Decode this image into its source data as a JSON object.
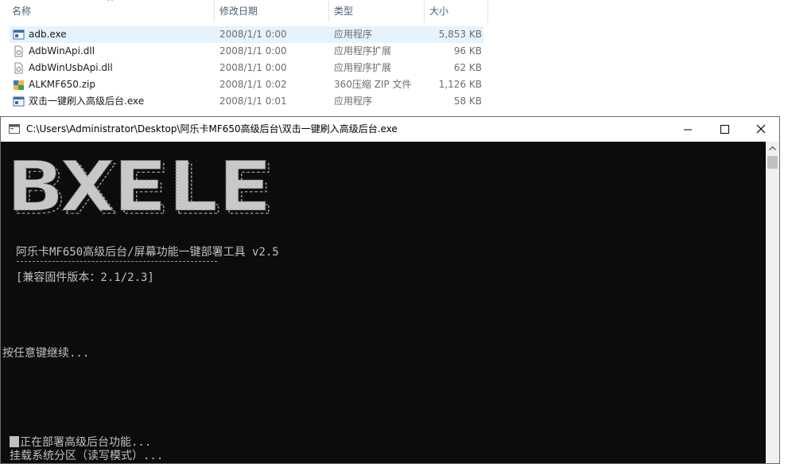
{
  "explorer": {
    "columns": {
      "name": "名称",
      "date": "修改日期",
      "type": "类型",
      "size": "大小"
    },
    "files": [
      {
        "name": "adb.exe",
        "date": "2008/1/1 0:00",
        "type": "应用程序",
        "size": "5,853 KB",
        "icon": "exe-icon",
        "selected": true
      },
      {
        "name": "AdbWinApi.dll",
        "date": "2008/1/1 0:00",
        "type": "应用程序扩展",
        "size": "96 KB",
        "icon": "dll-icon"
      },
      {
        "name": "AdbWinUsbApi.dll",
        "date": "2008/1/1 0:00",
        "type": "应用程序扩展",
        "size": "62 KB",
        "icon": "dll-icon"
      },
      {
        "name": "ALKMF650.zip",
        "date": "2008/1/1 0:02",
        "type": "360压缩 ZIP 文件",
        "size": "1,126 KB",
        "icon": "zip-icon"
      },
      {
        "name": "双击一键刷入高级后台.exe",
        "date": "2008/1/1 0:01",
        "type": "应用程序",
        "size": "58 KB",
        "icon": "exe-icon"
      }
    ]
  },
  "console": {
    "title": "C:\\Users\\Administrator\\Desktop\\阿乐卡MF650高级后台\\双击一键刷入高级后台.exe",
    "banner_text": "BXELE",
    "lines": {
      "tool_name": "阿乐卡MF650高级后台/屏幕功能一键部署工具 v2.5",
      "compat": "[兼容固件版本：2.1/2.3]",
      "press_key": "按任意键继续...",
      "deploying": "正在部署高级后台功能...",
      "mounting": "挂载系统分区（读写模式）..."
    }
  },
  "colors": {
    "console_bg": "#0c0c0c",
    "console_fg": "#c0c0c0",
    "selection": "#e5f3ff"
  }
}
